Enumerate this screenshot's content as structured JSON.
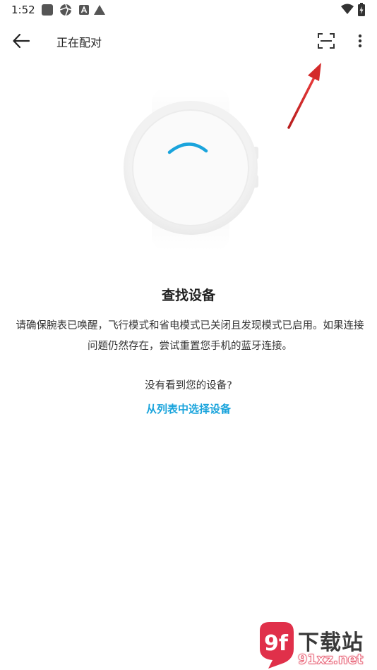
{
  "status_bar": {
    "time": "1:52"
  },
  "app_bar": {
    "title": "正在配对"
  },
  "main": {
    "heading": "查找设备",
    "description": "请确保腕表已唤醒，飞行模式和省电模式已关闭且发现模式已启用。如果连接问题仍然存在，尝试重置您手机的蓝牙连接。",
    "no_device_text": "没有看到您的设备?",
    "select_from_list": "从列表中选择设备"
  },
  "watermark": {
    "logo_text": "9f",
    "title": "下载站",
    "site": "91xz.net"
  },
  "colors": {
    "accent": "#1aa4dc",
    "annotation_arrow": "#d42a2a"
  }
}
